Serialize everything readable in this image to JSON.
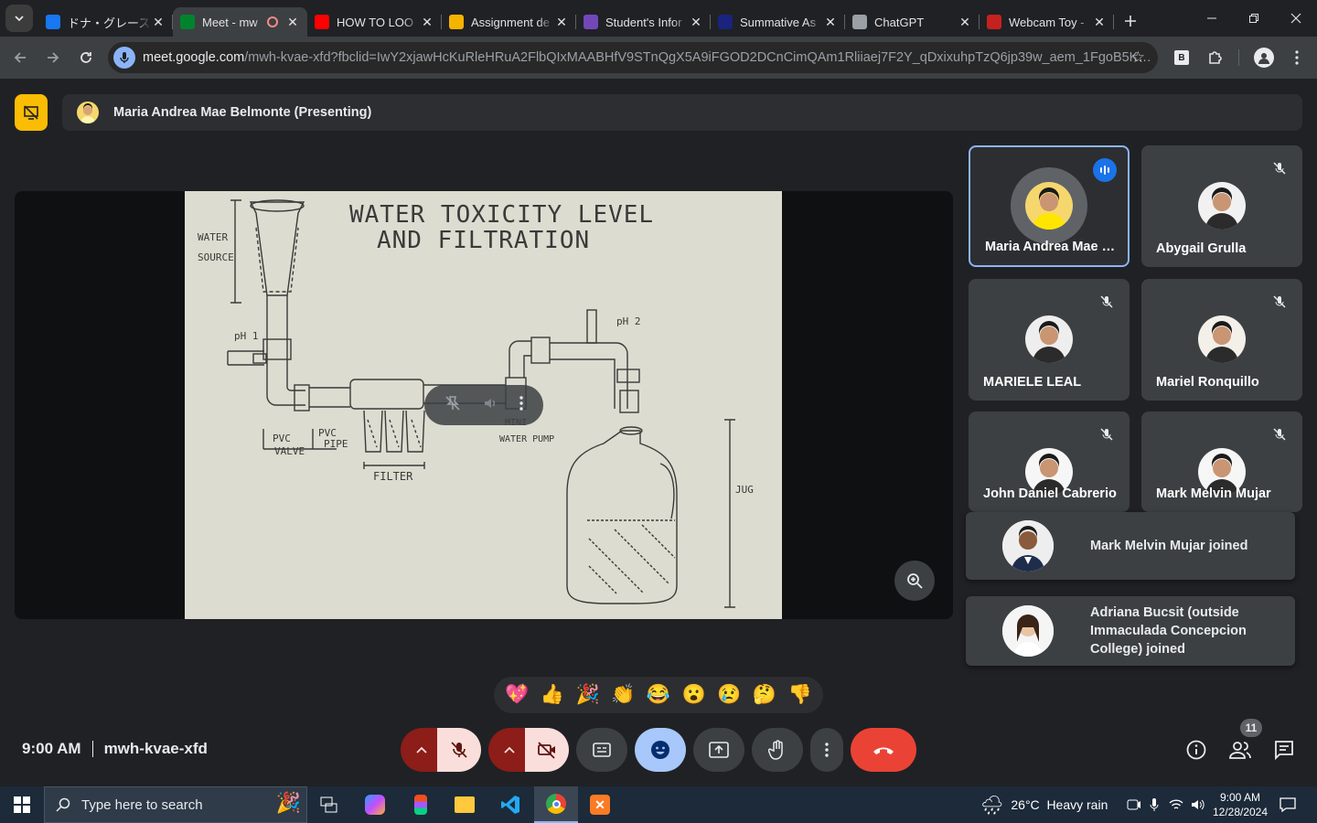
{
  "browser": {
    "tabs": [
      {
        "title": "ドナ・グレース・m",
        "favicon_color": "#1877f2",
        "icon": "facebook-icon"
      },
      {
        "title": "Meet - mw",
        "favicon_color": "#00832d",
        "icon": "meet-icon",
        "active": true
      },
      {
        "title": "HOW TO LOO",
        "favicon_color": "#ff0000",
        "icon": "youtube-icon"
      },
      {
        "title": "Assignment de",
        "favicon_color": "#f4b400",
        "icon": "classroom-icon"
      },
      {
        "title": "Student's Infor",
        "favicon_color": "#7248b9",
        "icon": "forms-icon"
      },
      {
        "title": "Summative As",
        "favicon_color": "#1a237e",
        "icon": "site-icon"
      },
      {
        "title": "ChatGPT",
        "favicon_color": "#9aa0a6",
        "icon": "chatgpt-icon"
      },
      {
        "title": "Webcam Toy -",
        "favicon_color": "#c5221f",
        "icon": "webcam-icon"
      }
    ],
    "url_host": "meet.google.com",
    "url_path": "/mwh-kvae-xfd?fbclid=IwY2xjawHcKuRleHRuA2FlbQIxMAABHfV9STnQgX5A9iFGOD2DCnCimQAm1Rliiaej7F2Y_qDxixuhpTzQ6jp39w_aem_1FgoB5KsbOk6..."
  },
  "meet": {
    "presenter_bar": "Maria Andrea Mae Belmonte (Presenting)",
    "slide": {
      "title_line1": "WATER TOXICITY LEVEL",
      "title_line2": "AND FILTRATION",
      "labels": {
        "water_source_1": "WATER",
        "water_source_2": "SOURCE",
        "ph1": "pH 1",
        "ph2": "pH 2",
        "pvc_valve_1": "PVC",
        "pvc_valve_2": "VALVE",
        "pvc_pipe_1": "PVC",
        "pvc_pipe_2": "PIPE",
        "filter": "FILTER",
        "mini_1": "MINI",
        "mini_2": "WATER PUMP",
        "jug": "JUG"
      }
    },
    "participants": [
      {
        "name": "Maria Andrea Mae B...",
        "speaking": true,
        "avatar_bg": "#f5d76e"
      },
      {
        "name": "Abygail Grulla",
        "muted": true,
        "avatar_bg": "#f1f1f1"
      },
      {
        "name": "MARIELE LEAL",
        "muted": true,
        "avatar_bg": "#eeeeee"
      },
      {
        "name": "Mariel Ronquillo",
        "muted": true,
        "avatar_bg": "#f3efe9"
      },
      {
        "name": "John Daniel Cabrerio",
        "muted": true,
        "avatar_bg": "#f6f6f6"
      },
      {
        "name": "Mark Melvin Mujar",
        "muted": true,
        "avatar_bg": "#f6f6f6"
      }
    ],
    "toasts": [
      {
        "text": "Mark Melvin Mujar joined"
      },
      {
        "text_line1": "Adriana Bucsit (outside",
        "text_line2": "Immaculada Concepcion",
        "text_line3": "College) joined"
      }
    ],
    "reactions": [
      "💖",
      "👍",
      "🎉",
      "👏",
      "😂",
      "😮",
      "😢",
      "🤔",
      "👎"
    ],
    "time": "9:00 AM",
    "meeting_code": "mwh-kvae-xfd",
    "people_count": "11"
  },
  "taskbar": {
    "search_placeholder": "Type here to search",
    "weather": "26°C  Heavy rain",
    "clock_time": "9:00 AM",
    "clock_date": "12/28/2024"
  }
}
